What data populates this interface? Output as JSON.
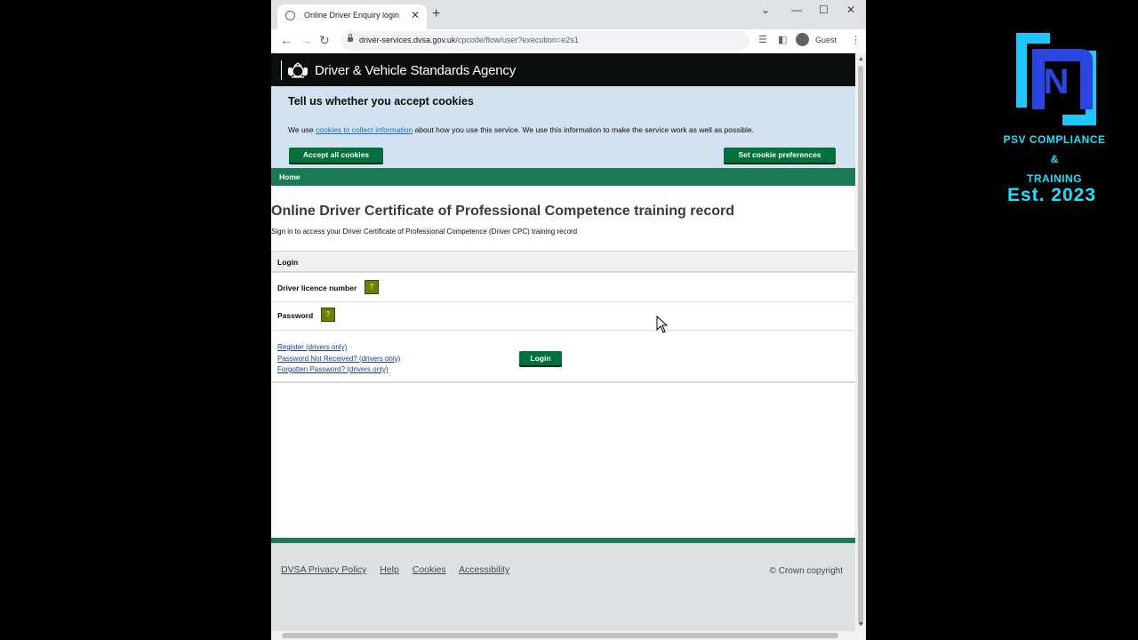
{
  "browser": {
    "tab_title": "Online Driver Enquiry login",
    "new_tab_symbol": "+",
    "url_host": "driver-services.dvsa.gov.uk",
    "url_path": "/cpcode/flow/user?execution=e2s1",
    "profile_label": "Guest"
  },
  "header": {
    "agency_name": "Driver & Vehicle Standards Agency"
  },
  "cookie_banner": {
    "heading": "Tell us whether you accept cookies",
    "text_before": "We use ",
    "link_text": "cookies to collect information",
    "text_after": " about how you use this service. We use this information to make the service work as well as possible.",
    "accept_label": "Accept all cookies",
    "preferences_label": "Set cookie preferences"
  },
  "nav": {
    "home_label": "Home"
  },
  "main": {
    "title": "Online Driver Certificate of Professional Competence training record",
    "subtitle": "Sign in to access your Driver Certificate of Professional Competence (Driver CPC) training record"
  },
  "login": {
    "panel_heading": "Login",
    "licence_label": "Driver licence number",
    "password_label": "Password",
    "help_symbol": "?",
    "login_button": "Login",
    "links": [
      "Register (drivers only)",
      "Password Not Received? (drivers only)",
      "Forgotten Password? (drivers only)"
    ]
  },
  "footer": {
    "links": [
      "DVSA Privacy Policy",
      "Help",
      "Cookies",
      "Accessibility"
    ],
    "copyright": "© Crown copyright"
  },
  "overlay": {
    "brand_line1": "PSV COMPLIANCE",
    "brand_line2": "&",
    "brand_line3": "TRAINING",
    "established": "Est. 2023"
  },
  "colors": {
    "gov_green": "#00703c",
    "nav_green": "#1a7a55",
    "cookie_bg": "#d2e2f0",
    "brand_cyan": "#1ee0ff"
  }
}
